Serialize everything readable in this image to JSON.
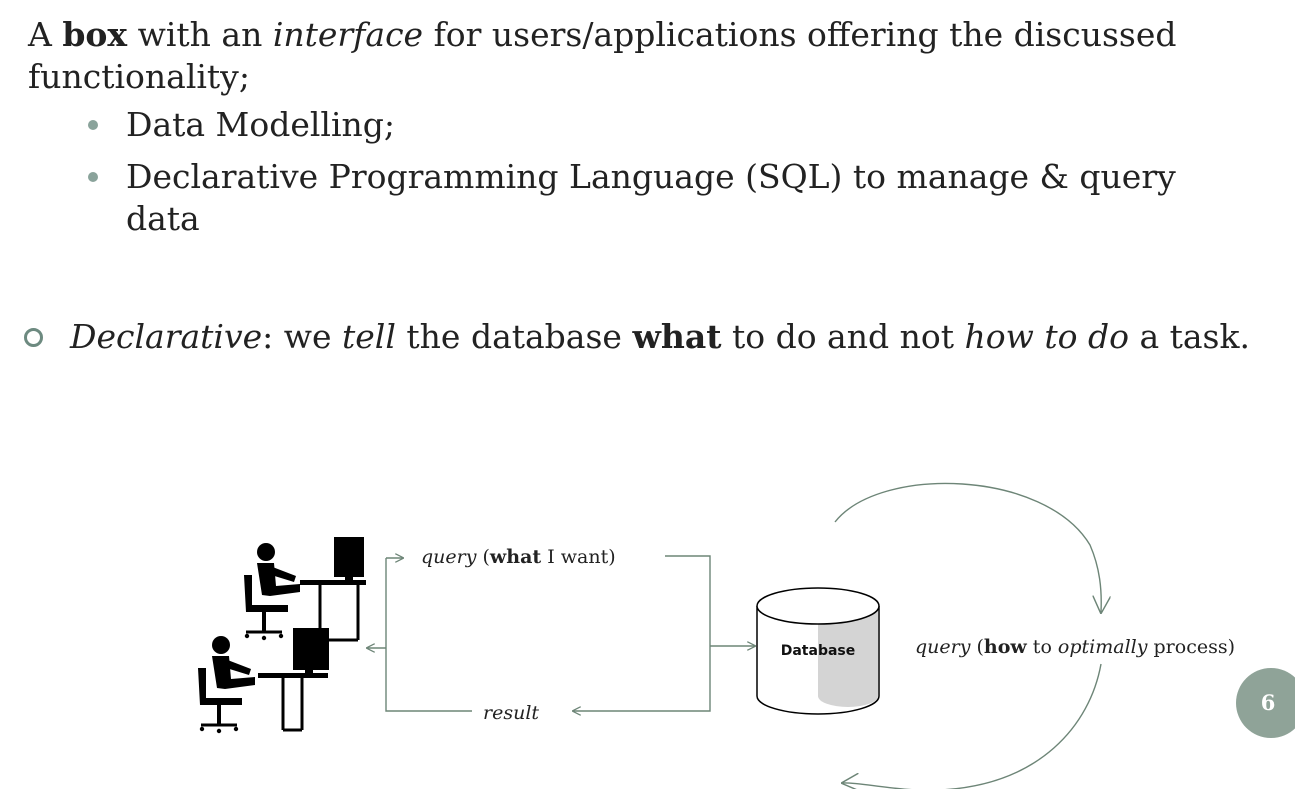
{
  "intro": {
    "p1": "A ",
    "p2": "box",
    "p3": " with an ",
    "p4": "interface",
    "p5": " for users/applications offering the discussed functionality;"
  },
  "bullets": [
    "Data Modelling;",
    "Declarative Programming Language (SQL) to manage & query data"
  ],
  "declarative": {
    "s1": "Declarative",
    "s2": ": we ",
    "s3": "tell",
    "s4": " the database ",
    "s5": "what",
    "s6": " to do and not ",
    "s7": "how to do",
    "s8": " a task."
  },
  "diagram": {
    "query_left": {
      "q": "query",
      "open": " (",
      "what": "what",
      "rest": " I want)"
    },
    "result": "result",
    "database": "Database",
    "query_right": {
      "q": "query",
      "open": " (",
      "how": "how",
      "mid": " to ",
      "opt": "optimally",
      "rest": " process)"
    }
  },
  "slide_number": "6",
  "colors": {
    "accent": "#8fa398",
    "arrow": "#6d8577",
    "text": "#222222"
  }
}
